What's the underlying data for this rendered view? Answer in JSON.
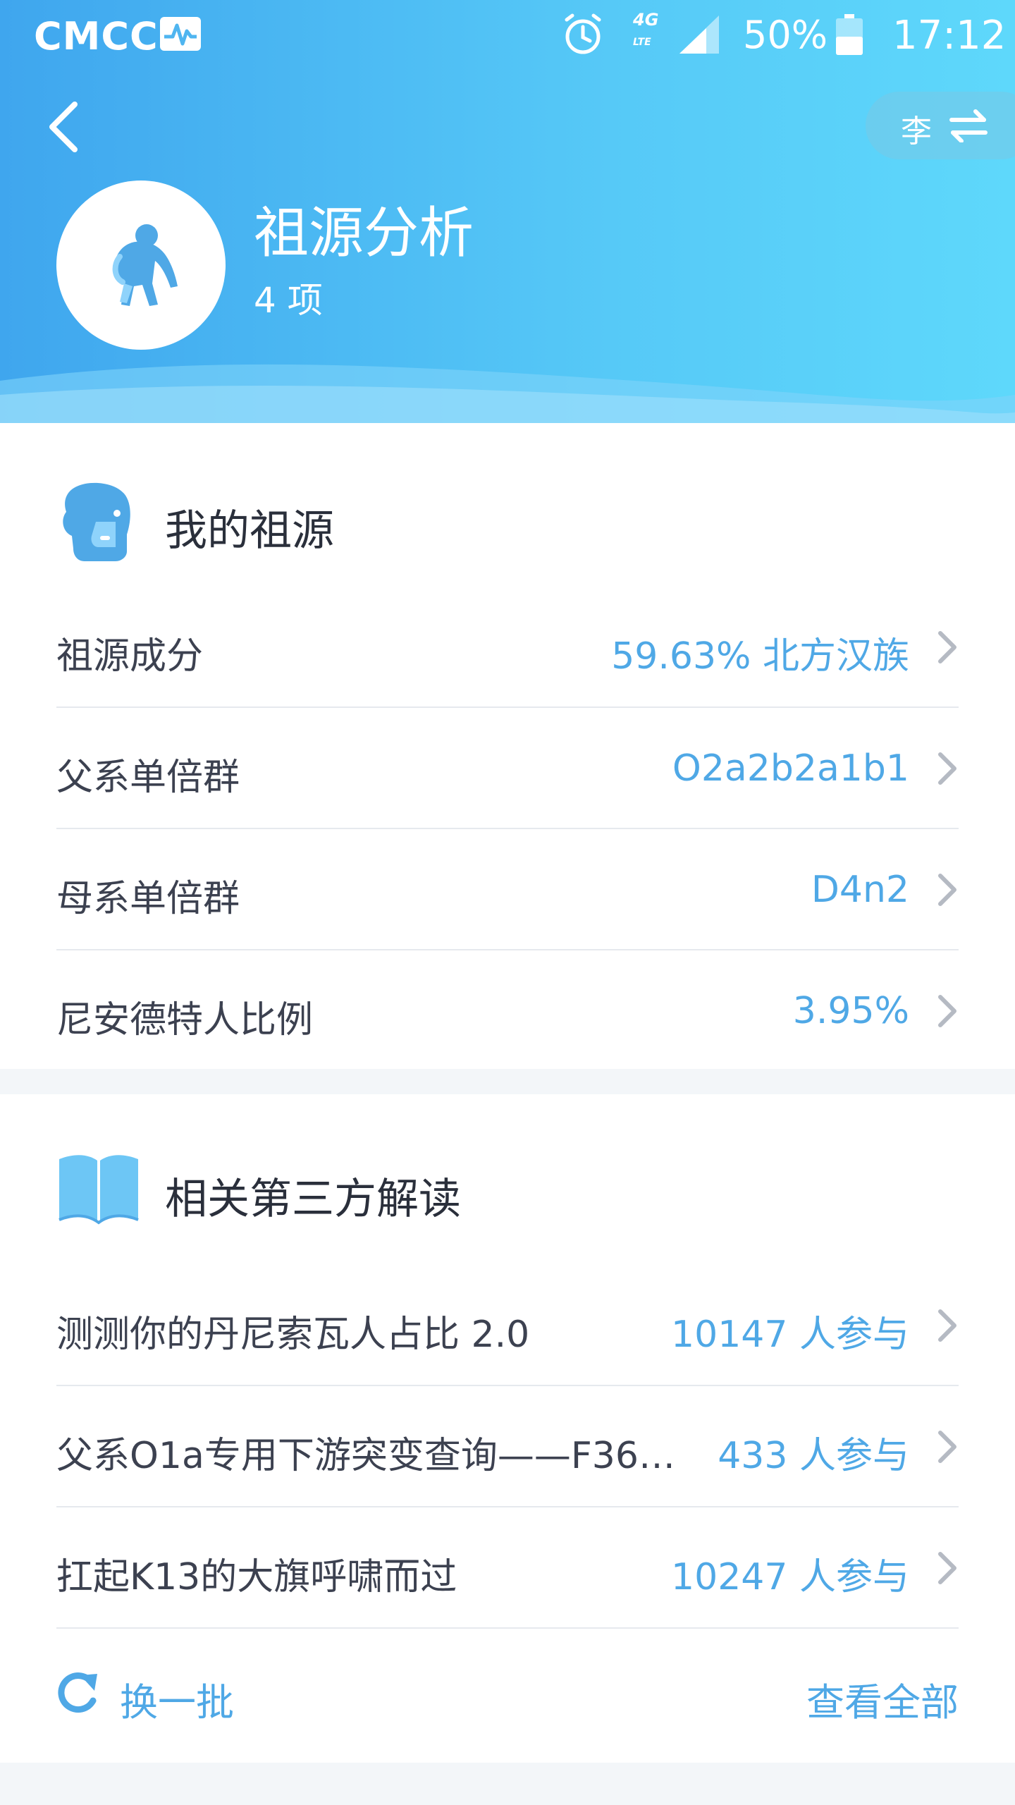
{
  "status_bar": {
    "carrier": "CMCC",
    "network": "4G",
    "network_sub": "LTE",
    "battery": "50%",
    "time": "17:12"
  },
  "header": {
    "title": "祖源分析",
    "subtitle": "4 项",
    "user_initial": "李",
    "gradient": [
      "#3fa6ee",
      "#5ed8fb"
    ]
  },
  "my_ancestry": {
    "title": "我的祖源",
    "rows": [
      {
        "label": "祖源成分",
        "value": "59.63% 北方汉族"
      },
      {
        "label": "父系单倍群",
        "value": "O2a2b2a1b1"
      },
      {
        "label": "母系单倍群",
        "value": "D4n2"
      },
      {
        "label": "尼安德特人比例",
        "value": "3.95%"
      }
    ]
  },
  "third_party": {
    "title": "相关第三方解读",
    "rows": [
      {
        "label": "测测你的丹尼索瓦人占比 2.0",
        "value": "10147 人参与"
      },
      {
        "label": "父系O1a专用下游突变查询——F36…",
        "value": "433 人参与"
      },
      {
        "label": "扛起K13的大旗呼啸而过",
        "value": "10247 人参与"
      }
    ],
    "refresh_label": "换一批",
    "view_all_label": "查看全部"
  },
  "colors": {
    "accent": "#4fa8e6",
    "text": "#3c4150",
    "divider": "#e6e9ee"
  }
}
